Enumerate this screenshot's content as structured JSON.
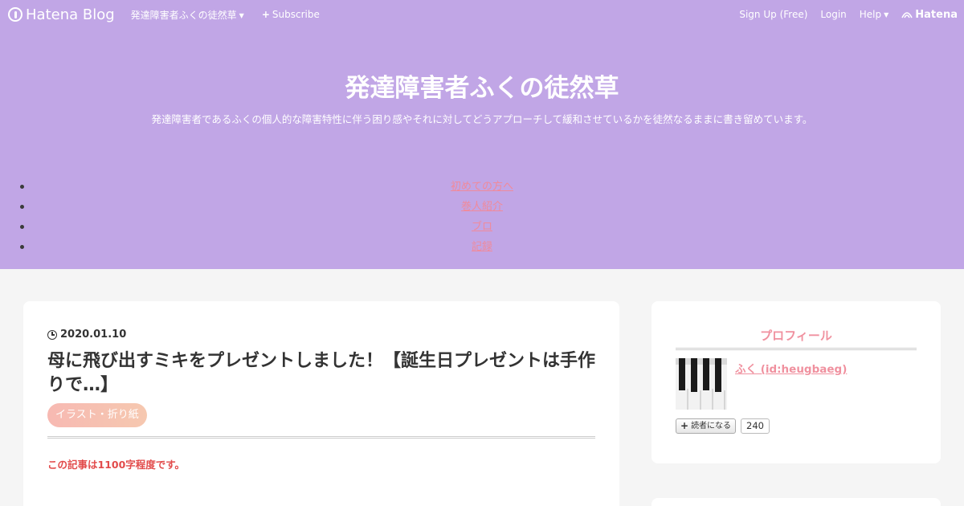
{
  "globalbar": {
    "logo_text": "Hatena Blog",
    "blog_menu_label": "発達障害者ふくの徒然草",
    "subscribe_label": "Subscribe",
    "signup_label": "Sign Up (Free)",
    "login_label": "Login",
    "help_label": "Help",
    "hatena_label": "Hatena"
  },
  "header": {
    "title": "発達障害者ふくの徒然草",
    "description": "発達障害者であるふくの個人的な障害特性に伴う困り感やそれに対してどうアプローチして緩和させているかを徒然なるままに書き留めています。",
    "nav": [
      "初めての方へ",
      "巻人紹介",
      "ブロ",
      "記録"
    ]
  },
  "entry": {
    "date": "2020.01.10",
    "title": "母に飛び出すミキをプレゼントしました！【誕生日プレゼントは手作りで…】",
    "category": "イラスト・折り紙",
    "notice": "この記事は1100字程度です。"
  },
  "sidebar": {
    "profile_title": "プロフィール",
    "profile_name": "ふく (id:heugbaeg)",
    "reader_button": "読者になる",
    "reader_count": "240"
  },
  "colors": {
    "header_bg": "#c1a6e6",
    "accent_pink": "#f0919f",
    "notice_red": "#e24b4b"
  }
}
